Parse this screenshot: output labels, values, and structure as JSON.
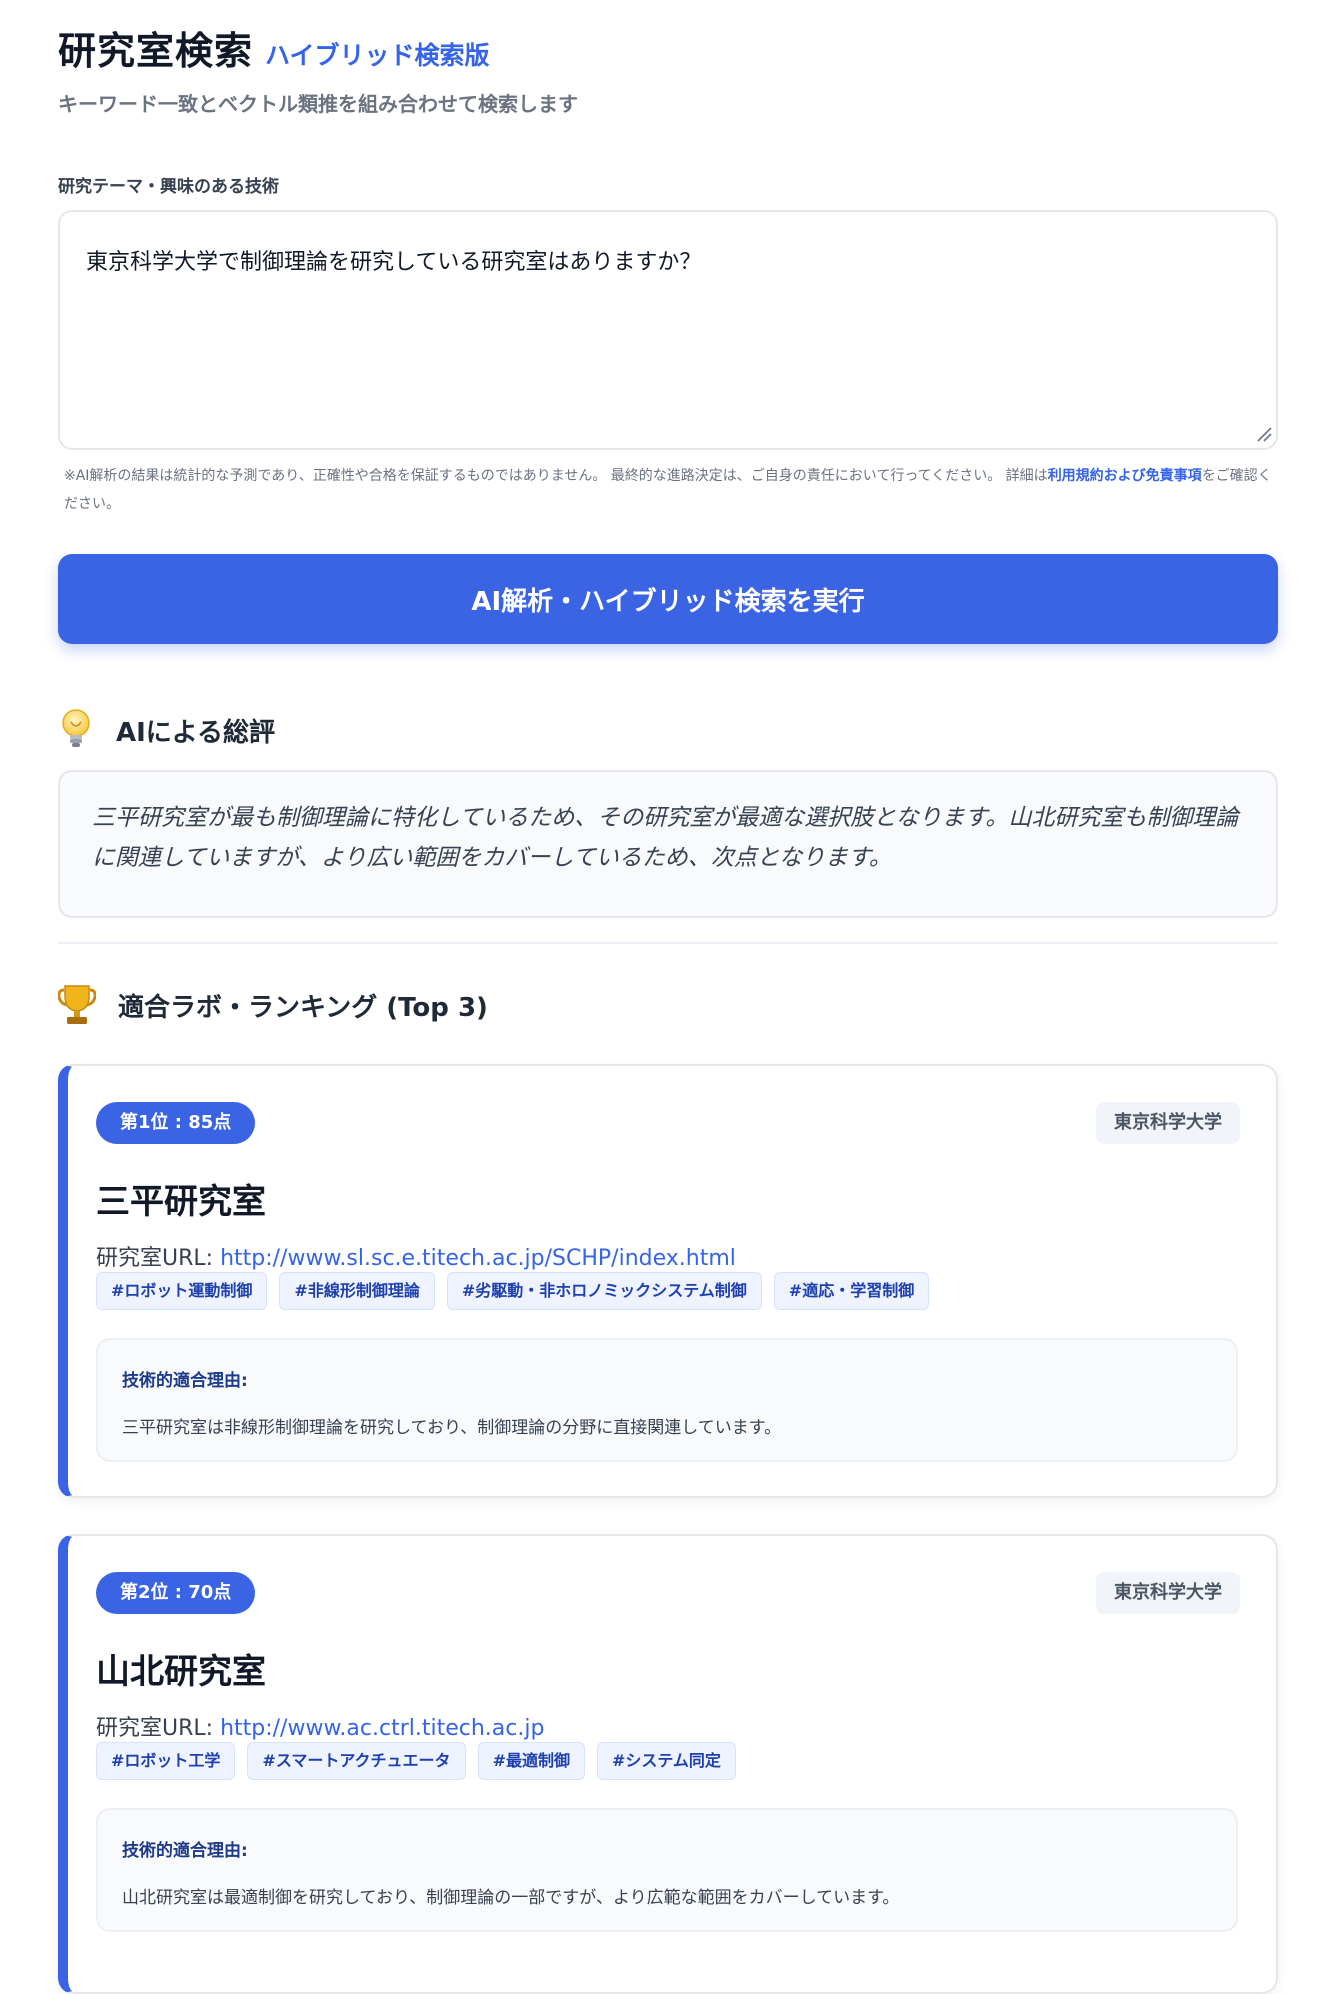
{
  "header": {
    "title": "研究室検索",
    "subtitle": "ハイブリッド検索版",
    "tagline": "キーワード一致とベクトル類推を組み合わせて検索します"
  },
  "query": {
    "label": "研究テーマ・興味のある技術",
    "value": "東京科学大学で制御理論を研究している研究室はありますか？"
  },
  "disclaimer": {
    "text": "※AI解析の結果は統計的な予測であり、正確性や合格を保証するものではありません。 最終的な進路決定は、ご自身の責任において行ってください。 詳細は",
    "link": "利用規約および免責事項",
    "suffix": "をご確認ください。"
  },
  "run_button": {
    "label": "AI解析・ハイブリッド検索を実行"
  },
  "summary": {
    "heading": "AIによる総評",
    "icon": "lightbulb-icon",
    "text": "三平研究室が最も制御理論に特化しているため、その研究室が最適な選択肢となります。山北研究室も制御理論に関連していますが、より広い範囲をカバーしているため、次点となります。"
  },
  "ranking": {
    "heading": "適合ラボ・ランキング (Top 3)",
    "icon": "trophy-icon",
    "labs": [
      {
        "rank": "第1位 : 85点",
        "university": "東京科学大学",
        "name": "三平研究室",
        "url_label": "研究室URL: ",
        "url": "http://www.sl.sc.e.titech.ac.jp/SCHP/index.html",
        "tags": [
          "#ロボット運動制御",
          "#非線形制御理論",
          "#劣駆動・非ホロノミックシステム制御",
          "#適応・学習制御"
        ],
        "reason_label": "技術的適合理由:",
        "reason": "三平研究室は非線形制御理論を研究しており、制御理論の分野に直接関連しています。"
      },
      {
        "rank": "第2位 : 70点",
        "university": "東京科学大学",
        "name": "山北研究室",
        "url_label": "研究室URL: ",
        "url": "http://www.ac.ctrl.titech.ac.jp",
        "tags": [
          "#ロボット工学",
          "#スマートアクチュエータ",
          "#最適制御",
          "#システム同定"
        ],
        "reason_label": "技術的適合理由:",
        "reason": "山北研究室は最適制御を研究しており、制御理論の一部ですが、より広範な範囲をカバーしています。"
      }
    ]
  },
  "colors": {
    "accent": "#3a64e4",
    "link": "#3563e9"
  }
}
